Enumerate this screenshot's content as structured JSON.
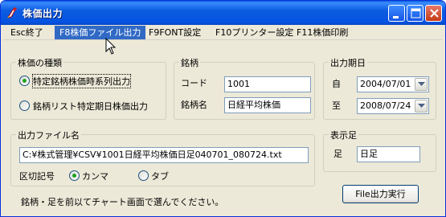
{
  "window": {
    "title": "株価出力",
    "icon": "app-flame-icon"
  },
  "menu": {
    "items": [
      "Esc終了",
      "F8株価ファイル出力",
      "F9FONT設定",
      "F10プリンター設定",
      "F11株価印刷"
    ],
    "active_index": 1
  },
  "type_group": {
    "legend": "株価の種類",
    "option1": "特定銘柄株価時系列出力",
    "option2": "銘柄リスト特定期日株価出力",
    "selected": "option1"
  },
  "stock_group": {
    "legend": "銘柄",
    "code_label": "コード",
    "code_value": "1001",
    "name_label": "銘柄名",
    "name_value": "日経平均株価"
  },
  "period_group": {
    "legend": "出力期日",
    "from_label": "自",
    "from_value": "2004/07/01",
    "to_label": "至",
    "to_value": "2008/07/24"
  },
  "file_group": {
    "legend": "出力ファイル名",
    "path": "C:¥株式管理¥CSV¥1001日経平均株価日足040701_080724.txt",
    "delimiter_label": "区切記号",
    "comma_label": "カンマ",
    "tab_label": "タブ",
    "selected": "comma"
  },
  "display_group": {
    "legend": "表示足",
    "foot_label": "足",
    "foot_value": "日足"
  },
  "hint_text": "銘柄・足を前以てチャート画面で選んでください。",
  "execute_button": "File出力実行",
  "colors": {
    "titlebar": "#0a5be0",
    "menu_active": "#316ac5",
    "window_bg": "#ece9d8"
  }
}
